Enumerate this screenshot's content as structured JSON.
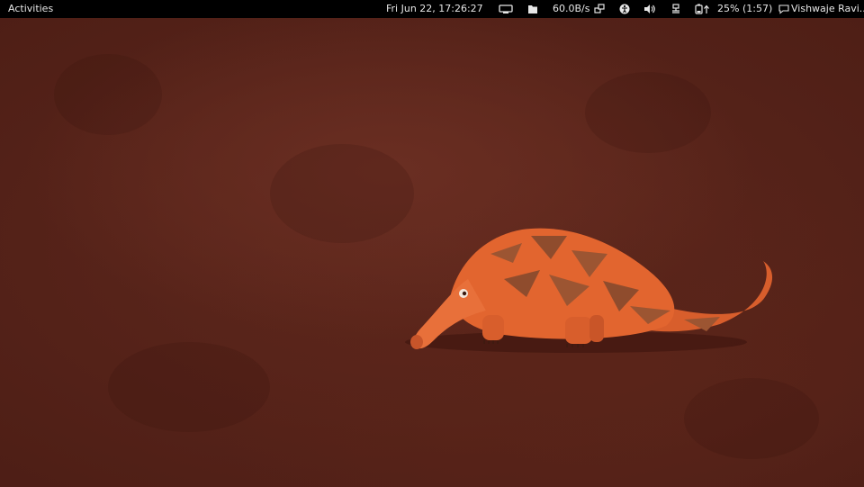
{
  "topbar": {
    "activities_label": "Activities",
    "clock": "Fri Jun 22, 17:26:27",
    "net_speed": "60.0B/s",
    "battery": "25% (1:57)",
    "user_name": "Vishwaje Ravi...",
    "icons": [
      "display-icon",
      "files-icon",
      "network-activity-icon",
      "accessibility-icon",
      "volume-icon",
      "wired-network-icon",
      "battery-icon",
      "chat-status-icon"
    ]
  },
  "colors": {
    "topbar_bg": "#000000",
    "topbar_text": "#e6e6e6",
    "wallpaper": "#5a2419",
    "mascot_orange": "#e2652f"
  }
}
